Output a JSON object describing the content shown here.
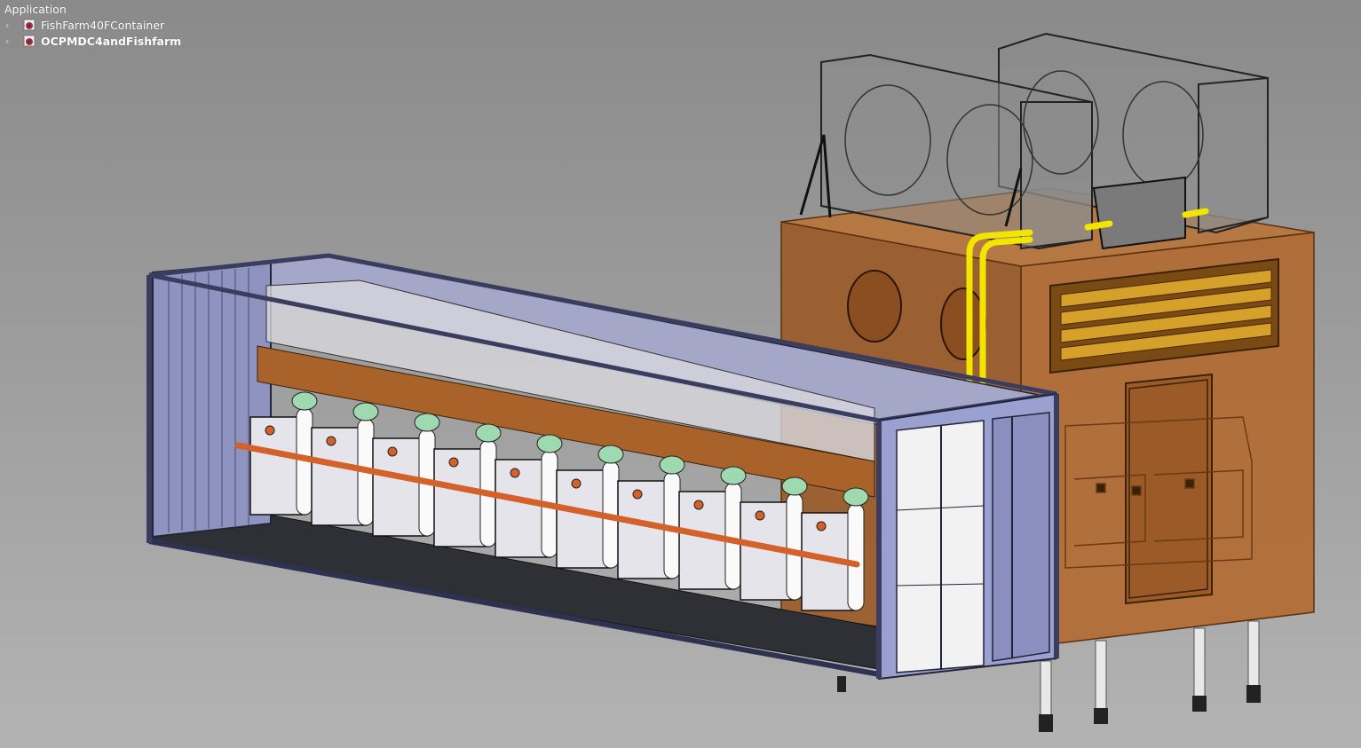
{
  "tree": {
    "root_label": "Application",
    "nodes": [
      {
        "label": "FishFarm40FContainer",
        "active": false,
        "icon": "document-icon"
      },
      {
        "label": "OCPMDC4andFishfarm",
        "active": true,
        "icon": "document-icon"
      }
    ]
  },
  "colors": {
    "background_top": "#8a8a8a",
    "background_bottom": "#b3b3b3",
    "container_frame": "#8e93c4",
    "building": "#a8622a",
    "pipe_orange": "#d4602a",
    "pipe_yellow": "#f2e600",
    "tank_cap": "#9fd9b0"
  }
}
